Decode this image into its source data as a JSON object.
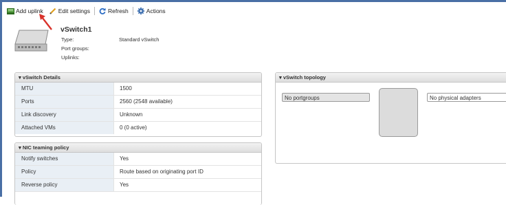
{
  "toolbar": {
    "add_uplink": "Add uplink",
    "edit_settings": "Edit settings",
    "refresh": "Refresh",
    "actions": "Actions"
  },
  "switch": {
    "name": "vSwitch1",
    "type_label": "Type:",
    "type_value": "Standard vSwitch",
    "port_groups_label": "Port groups:",
    "uplinks_label": "Uplinks:"
  },
  "details": {
    "title": "vSwitch Details",
    "rows": [
      {
        "label": "MTU",
        "value": "1500"
      },
      {
        "label": "Ports",
        "value": "2560 (2548 available)"
      },
      {
        "label": "Link discovery",
        "value": "Unknown"
      },
      {
        "label": "Attached VMs",
        "value": "0 (0 active)"
      }
    ]
  },
  "teaming": {
    "title": "NIC teaming policy",
    "rows": [
      {
        "label": "Notify switches",
        "value": "Yes"
      },
      {
        "label": "Policy",
        "value": "Route based on originating port ID"
      },
      {
        "label": "Reverse policy",
        "value": "Yes"
      }
    ]
  },
  "topology": {
    "title": "vSwitch topology",
    "portgroups": "No portgroups",
    "adapters": "No physical adapters"
  },
  "colors": {
    "accent": "#4a6fa5",
    "key_cell_bg": "#e9eff5",
    "arrow": "#d9322b"
  },
  "icons": [
    "add-uplink-icon",
    "edit-pencil-icon",
    "refresh-icon",
    "gear-icon",
    "chevron-down-icon",
    "switch-icon"
  ]
}
